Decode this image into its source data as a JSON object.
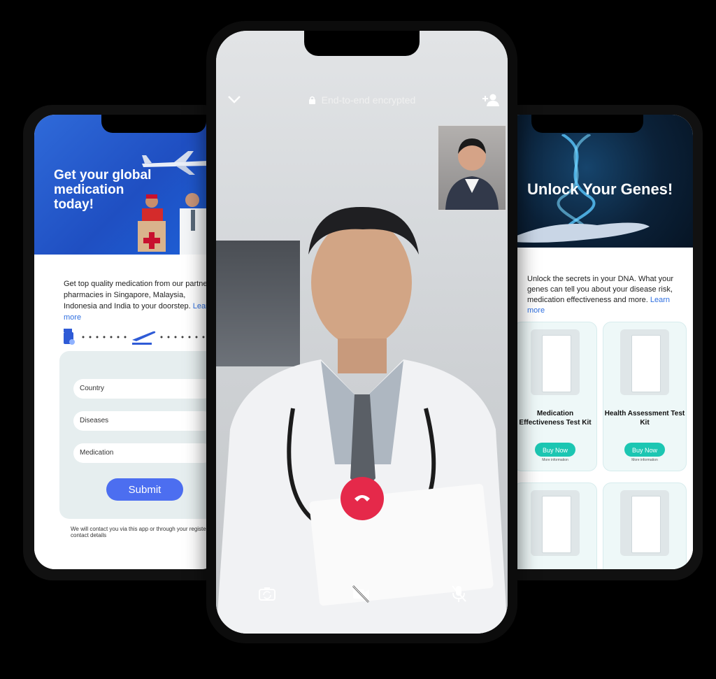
{
  "left_app": {
    "hero_title": "Get your global medication today!",
    "description": "Get top quality medication from our partner pharmacies in Singapore, Malaysia, Indonesia and India to your doorstep.",
    "learn_more": "Learn more",
    "form": {
      "country_placeholder": "Country",
      "diseases_placeholder": "Diseases",
      "medication_placeholder": "Medication",
      "submit_label": "Submit"
    },
    "footer_note": "We will contact you via this app or through your registered contact details"
  },
  "call_app": {
    "encryption_label": "End-to-end encrypted",
    "icons": [
      "chevron-down-icon",
      "lock-icon",
      "add-person-icon",
      "end-call-icon",
      "switch-camera-icon",
      "video-off-icon",
      "mic-off-icon"
    ],
    "end_call_color": "#e5294a"
  },
  "right_app": {
    "hero_title": "Unlock Your Genes!",
    "description": "Unlock the secrets in your DNA. What your genes can tell you about your disease risk, medication effectiveness and more.",
    "learn_more": "Learn more",
    "products": [
      {
        "title": "Medication Effectiveness Test Kit",
        "button": "Buy Now",
        "more": "More information"
      },
      {
        "title": "Health Assessment Test Kit",
        "button": "Buy Now",
        "more": "More information"
      }
    ],
    "accent_color": "#1cc6b2"
  }
}
